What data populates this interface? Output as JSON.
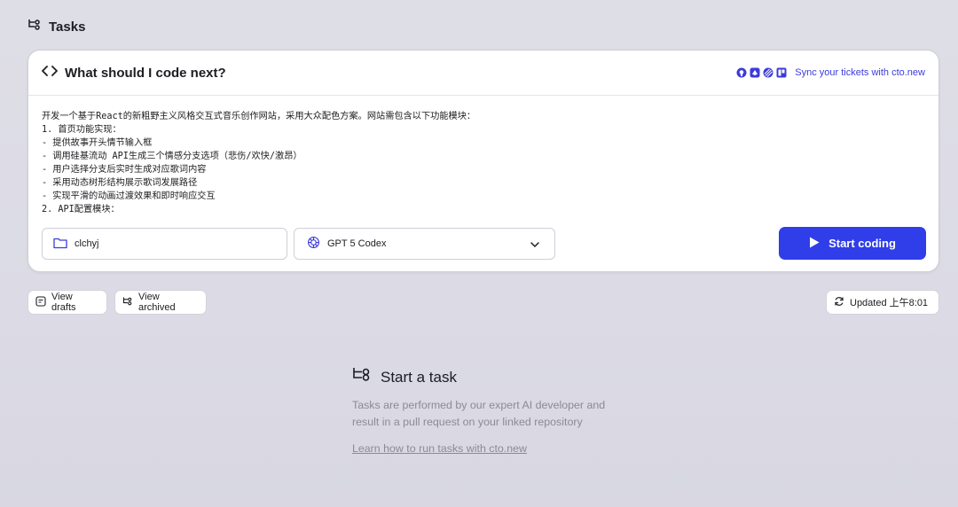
{
  "page": {
    "title": "Tasks",
    "title_icon": "task-flow-icon"
  },
  "composer": {
    "heading": "What should I code next?",
    "heading_icon": "code-brackets-icon",
    "integrations": [
      "github-icon",
      "gitlab-icon",
      "linear-icon",
      "trello-icon"
    ],
    "sync_link": "Sync your tickets with cto.new",
    "prompt_text": "开发一个基于React的新粗野主义风格交互式音乐创作网站，采用大众配色方案。网站需包含以下功能模块：\n1. 首页功能实现：\n- 提供故事开头情节输入框\n- 调用硅基流动 API生成三个情感分支选项（悲伤/欢快/激昂）\n- 用户选择分支后实时生成对应歌词内容\n- 采用动态树形结构展示歌词发展路径\n- 实现平滑的动画过渡效果和即时响应交互\n2. API配置模块：",
    "repo": "clchyj",
    "model": "GPT 5 Codex",
    "start_button": "Start coding",
    "accent_color": "#2f3ee8"
  },
  "toolbar": {
    "drafts_label": "View drafts",
    "archived_label": "View archived",
    "updated_label": "Updated 上午8:01"
  },
  "empty_state": {
    "title": "Start a task",
    "description": "Tasks are performed by our expert AI developer and result in a pull request on your linked repository",
    "link": "Learn how to run tasks with cto.new"
  }
}
